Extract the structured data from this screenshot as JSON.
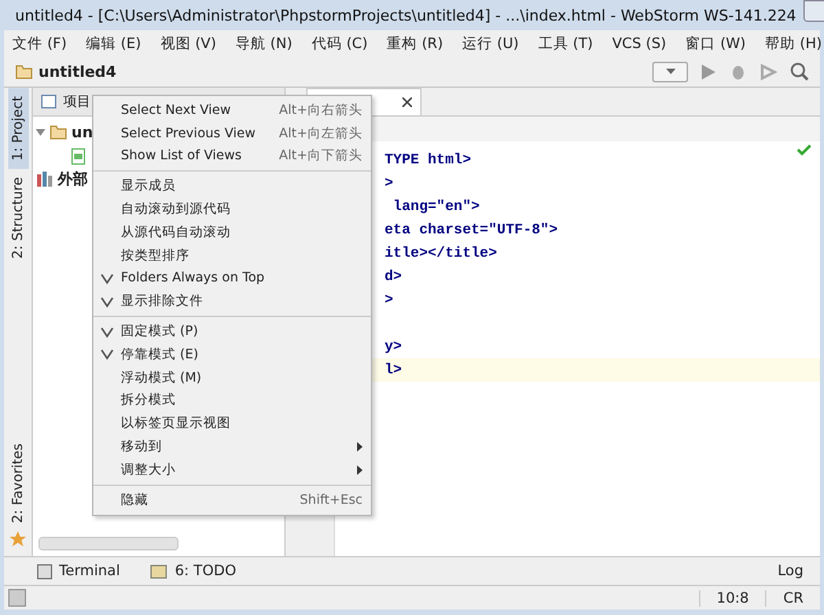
{
  "window": {
    "title": "untitled4 - [C:\\Users\\Administrator\\PhpstormProjects\\untitled4] - ...\\index.html - WebStorm WS-141.224"
  },
  "menu_bar": [
    "文件 (F)",
    "编辑 (E)",
    "视图 (V)",
    "导航 (N)",
    "代码 (C)",
    "重构 (R)",
    "运行 (U)",
    "工具 (T)",
    "VCS (S)",
    "窗口 (W)",
    "帮助 (H)"
  ],
  "breadcrumb": "untitled4",
  "left_tabs": [
    {
      "label": "1: Project",
      "selected": true
    },
    {
      "label": "2: Structure",
      "selected": false
    }
  ],
  "bottom_left_tabs": [
    {
      "label": "2: Favorites",
      "selected": false
    }
  ],
  "project_panel": {
    "title": "项目",
    "tree": [
      {
        "label": "un",
        "expanded": true,
        "children": [
          {
            "kind": "html"
          }
        ]
      },
      {
        "label": "外部"
      }
    ]
  },
  "editor": {
    "lines": [
      {
        "text": "TYPE html>",
        "highlighted": false
      },
      {
        "text": ">",
        "highlighted": false
      },
      {
        "text": " lang=\"en\">",
        "highlighted": false
      },
      {
        "text": "eta charset=\"UTF-8\">",
        "highlighted": false
      },
      {
        "text": "itle></title>",
        "highlighted": false
      },
      {
        "text": "d>",
        "highlighted": false
      },
      {
        "text": ">",
        "highlighted": false
      },
      {
        "highlighted": false
      },
      {
        "text": "y>",
        "highlighted": false
      },
      {
        "text": "l>",
        "highlighted": true
      }
    ]
  },
  "context_menu": [
    {
      "kind": "item",
      "label": "Select Next View",
      "shortcut": "Alt+向右箭头"
    },
    {
      "kind": "item",
      "label": "Select Previous View",
      "shortcut": "Alt+向左箭头"
    },
    {
      "kind": "item",
      "label": "Show List of Views",
      "shortcut": "Alt+向下箭头"
    },
    {
      "kind": "separator"
    },
    {
      "kind": "check",
      "label": "显示成员",
      "checked": false
    },
    {
      "kind": "check",
      "label": "自动滚动到源代码",
      "checked": false
    },
    {
      "kind": "check",
      "label": "从源代码自动滚动",
      "checked": false
    },
    {
      "kind": "check",
      "label": "按类型排序",
      "checked": false
    },
    {
      "kind": "check",
      "label": "Folders Always on Top",
      "checked": true
    },
    {
      "kind": "check",
      "label": "显示排除文件",
      "checked": true
    },
    {
      "kind": "separator"
    },
    {
      "kind": "check",
      "label": "固定模式 (P)",
      "checked": true
    },
    {
      "kind": "check",
      "label": "停靠模式 (E)",
      "checked": true
    },
    {
      "kind": "check",
      "label": "浮动模式 (M)",
      "checked": false
    },
    {
      "kind": "check",
      "label": "拆分模式",
      "checked": false
    },
    {
      "kind": "check",
      "label": "以标签页显示视图",
      "checked": false
    },
    {
      "kind": "submenu",
      "label": "移动到"
    },
    {
      "kind": "submenu",
      "label": "调整大小"
    },
    {
      "kind": "separator"
    },
    {
      "kind": "item",
      "label": "隐藏",
      "shortcut": "Shift+Esc"
    }
  ],
  "tool_windows": [
    {
      "kind": "terminal",
      "label": "Terminal"
    },
    {
      "kind": "todo",
      "label": "6: TODO"
    },
    {
      "kind": "log",
      "label": "Log"
    }
  ],
  "status_bar": [
    "10:8",
    "CR"
  ]
}
